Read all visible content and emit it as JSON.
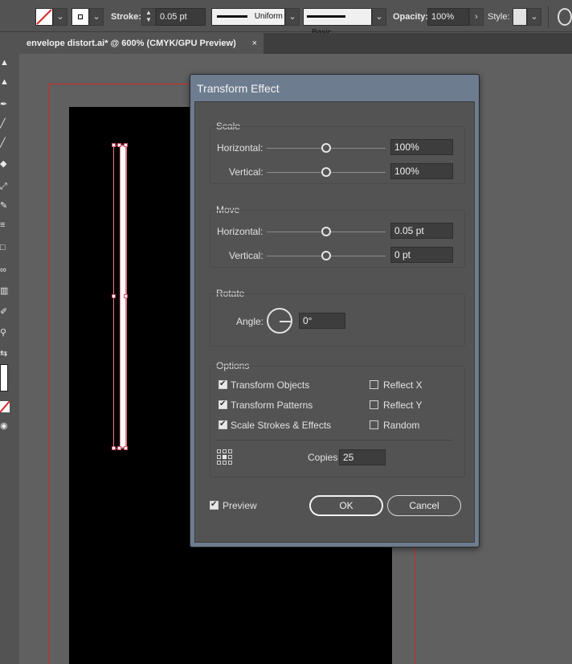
{
  "control_bar": {
    "stroke_label": "Stroke:",
    "stroke_value": "0.05 pt",
    "profile_uniform": "Uniform",
    "brush_basic": "Basic",
    "opacity_label": "Opacity:",
    "opacity_value": "100%",
    "style_label": "Style:",
    "chevron": "⌄",
    "arrow_right": "›"
  },
  "document_tab": {
    "title": "envelope distort.ai* @ 600% (CMYK/GPU Preview)",
    "close": "×"
  },
  "dialog": {
    "title": "Transform Effect",
    "scale": {
      "title": "Scale",
      "horizontal_label": "Horizontal:",
      "horizontal_value": "100%",
      "vertical_label": "Vertical:",
      "vertical_value": "100%"
    },
    "move": {
      "title": "Move",
      "horizontal_label": "Horizontal:",
      "horizontal_value": "0.05 pt",
      "vertical_label": "Vertical:",
      "vertical_value": "0 pt"
    },
    "rotate": {
      "title": "Rotate",
      "angle_label": "Angle:",
      "angle_value": "0°"
    },
    "options": {
      "title": "Options",
      "transform_objects": "Transform Objects",
      "transform_patterns": "Transform Patterns",
      "scale_strokes": "Scale Strokes & Effects",
      "reflect_x": "Reflect X",
      "reflect_y": "Reflect Y",
      "random": "Random",
      "copies_label": "Copies",
      "copies_value": "25",
      "checked": {
        "transform_objects": true,
        "transform_patterns": true,
        "scale_strokes": true,
        "reflect_x": false,
        "reflect_y": false,
        "random": false
      }
    },
    "preview_label": "Preview",
    "preview_checked": true,
    "ok_label": "OK",
    "cancel_label": "Cancel"
  },
  "colors": {
    "ui_background": "#535353",
    "artboard": "#000000",
    "bleed_guide": "#d42a2a",
    "selection": "#e8788a",
    "dialog_title_bar": "#6d7c8f"
  }
}
